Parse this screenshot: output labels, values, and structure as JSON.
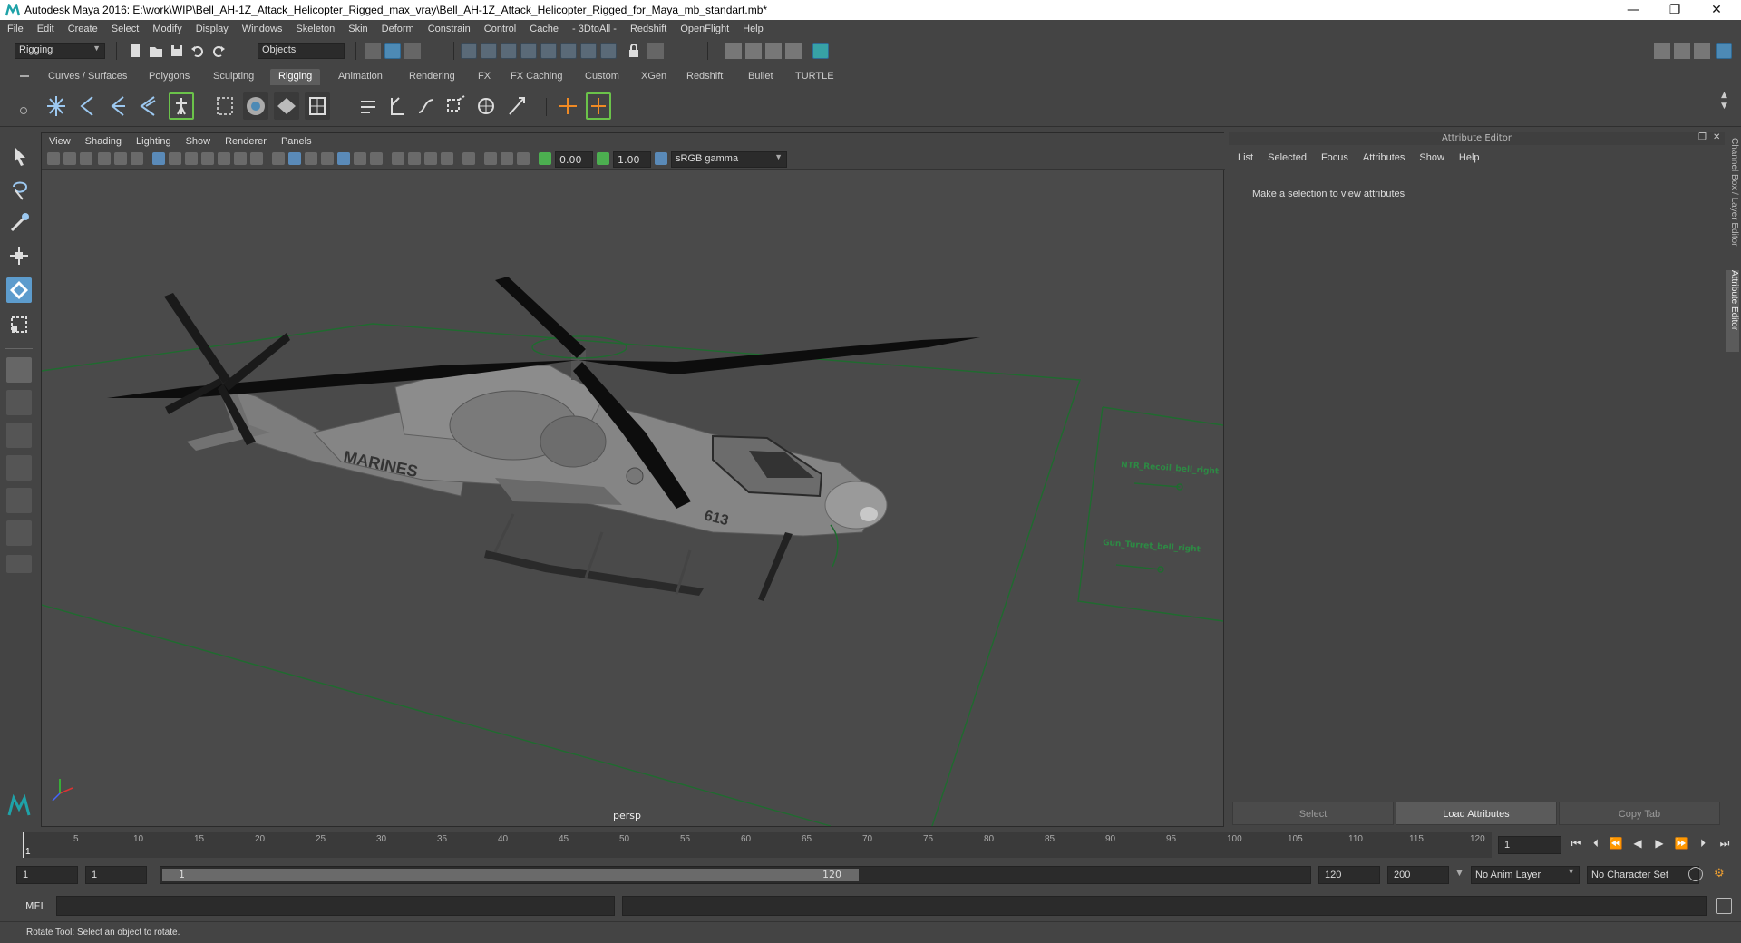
{
  "title": "Autodesk Maya 2016: E:\\work\\WIP\\Bell_AH-1Z_Attack_Helicopter_Rigged_max_vray\\Bell_AH-1Z_Attack_Helicopter_Rigged_for_Maya_mb_standart.mb*",
  "window_controls": {
    "minimize": "—",
    "restore": "❐",
    "close": "✕"
  },
  "menus": [
    "File",
    "Edit",
    "Create",
    "Select",
    "Modify",
    "Display",
    "Windows",
    "Skeleton",
    "Skin",
    "Deform",
    "Constrain",
    "Control",
    "Cache",
    "- 3DtoAll -",
    "Redshift",
    "OpenFlight",
    "Help"
  ],
  "status": {
    "menuset": "Rigging",
    "select_mode": "Objects"
  },
  "shelf_tabs": [
    "Curves / Surfaces",
    "Polygons",
    "Sculpting",
    "Rigging",
    "Animation",
    "Rendering",
    "FX",
    "FX Caching",
    "Custom",
    "XGen",
    "Redshift",
    "Bullet",
    "TURTLE"
  ],
  "active_shelf": "Rigging",
  "viewport": {
    "menus": [
      "View",
      "Shading",
      "Lighting",
      "Show",
      "Renderer",
      "Panels"
    ],
    "exposure": "0.00",
    "gamma": "1.00",
    "colorspace": "sRGB gamma",
    "camera": "persp",
    "aircraft_text": "MARINES",
    "tail_number": "613",
    "ctrl_labels": [
      "NTR_Recoil_bell_right",
      "Gun_Turret_bell_right"
    ]
  },
  "attribute_editor": {
    "title": "Attribute Editor",
    "menus": [
      "List",
      "Selected",
      "Focus",
      "Attributes",
      "Show",
      "Help"
    ],
    "message": "Make a selection to view attributes",
    "buttons": {
      "select": "Select",
      "load": "Load Attributes",
      "copy": "Copy Tab"
    }
  },
  "side_tabs": [
    "Channel Box / Layer Editor",
    "Attribute Editor"
  ],
  "timeline": {
    "ticks": [
      "5",
      "10",
      "15",
      "20",
      "25",
      "30",
      "35",
      "40",
      "45",
      "50",
      "55",
      "60",
      "65",
      "70",
      "75",
      "80",
      "85",
      "90",
      "95",
      "100",
      "105",
      "110",
      "115",
      "120"
    ],
    "current_frame_label": "1",
    "current_frame_field": "1"
  },
  "range": {
    "start": "1",
    "playback_start": "1",
    "slider_start": "1",
    "slider_end": "120",
    "playback_end": "120",
    "end": "200",
    "anim_layer": "No Anim Layer",
    "char_set": "No Character Set"
  },
  "command_line": {
    "label": "MEL"
  },
  "help_line": "Rotate Tool: Select an object to rotate."
}
